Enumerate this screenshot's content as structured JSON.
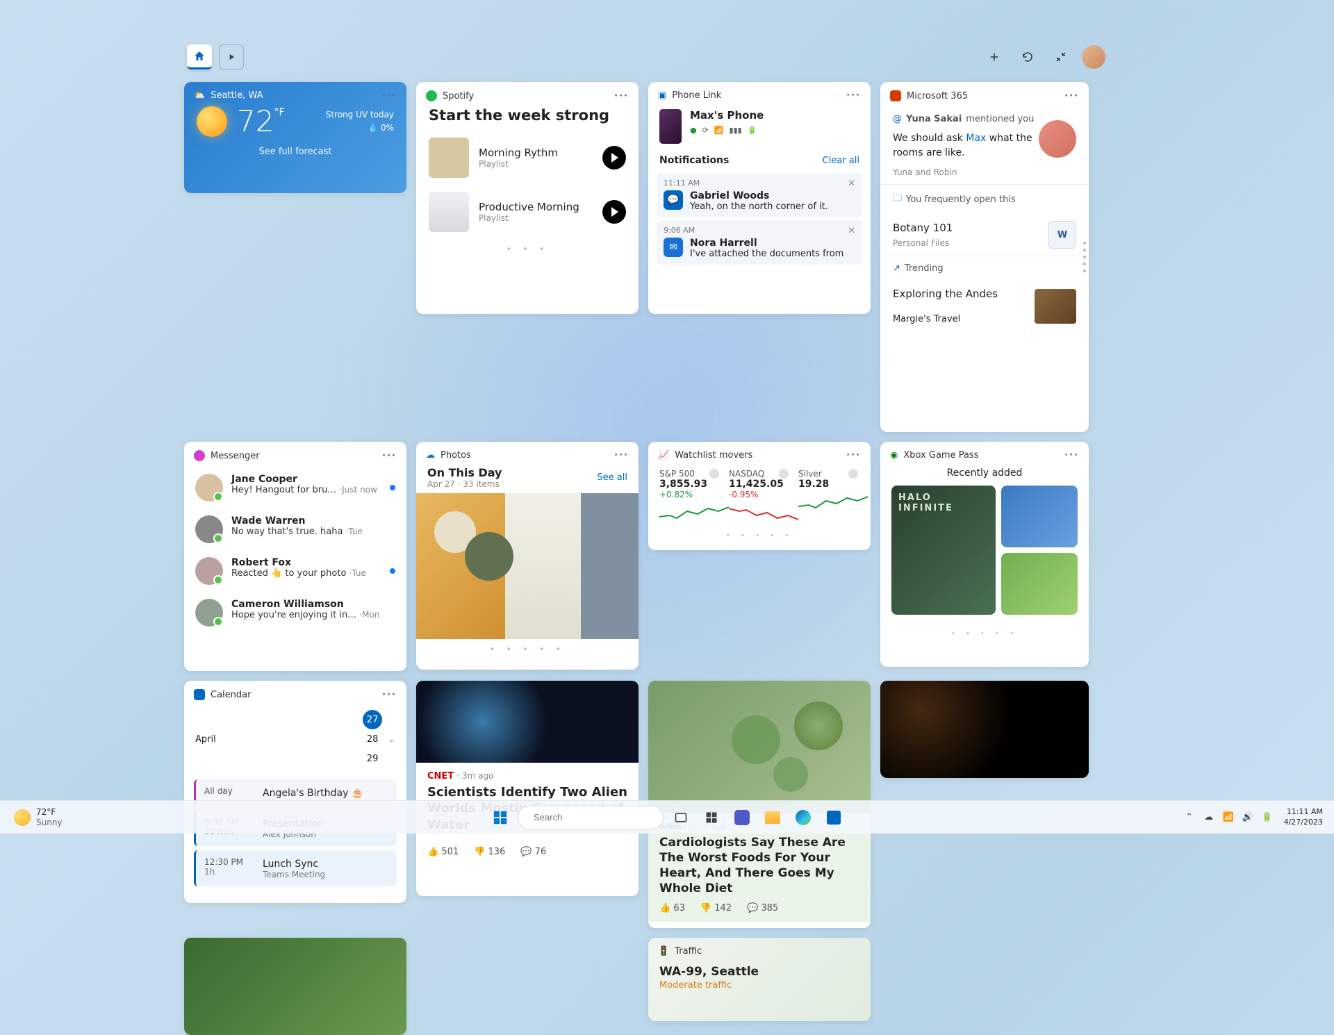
{
  "topbar": {
    "home_label": "Home",
    "play_label": "Play"
  },
  "weather": {
    "title": "Seattle, WA",
    "temp": "72",
    "unit": "°F",
    "note_top": "Strong UV today",
    "note_bottom": "0%",
    "forecast_link": "See full forecast"
  },
  "messenger": {
    "title": "Messenger",
    "items": [
      {
        "name": "Jane Cooper",
        "preview": "Hey! Hangout for bru…",
        "time": "Just now",
        "unread": true,
        "avatar_color": "#d8c0a0"
      },
      {
        "name": "Wade Warren",
        "preview": "No way that's true. haha",
        "time": "Tue",
        "unread": false,
        "avatar_color": "#888"
      },
      {
        "name": "Robert Fox",
        "preview": "Reacted 👆 to your photo",
        "time": "Tue",
        "unread": true,
        "avatar_color": "#bba0a0"
      },
      {
        "name": "Cameron Williamson",
        "preview": "Hope you're enjoying it in…",
        "time": "Mon",
        "unread": false,
        "avatar_color": "#90a090"
      }
    ]
  },
  "calendar": {
    "title": "Calendar",
    "month": "April",
    "days": [
      "27",
      "28",
      "29"
    ],
    "selected_index": 0,
    "events": [
      {
        "slot": "All day",
        "dur": "",
        "title": "Angela's Birthday 🎂",
        "sub": "",
        "accent": "pink"
      },
      {
        "slot": "8:30 AM",
        "dur": "30 min",
        "title": "Presentation",
        "sub": "Alex Johnson",
        "accent": "blue"
      },
      {
        "slot": "12:30 PM",
        "dur": "1h",
        "title": "Lunch Sync",
        "sub": "Teams Meeting",
        "accent": "blue"
      }
    ]
  },
  "spotify": {
    "title": "Spotify",
    "headline": "Start the week strong",
    "items": [
      {
        "name": "Morning Rythm",
        "sub": "Playlist"
      },
      {
        "name": "Productive Morning",
        "sub": "Playlist"
      }
    ]
  },
  "photos": {
    "title": "Photos",
    "headline": "On This Day",
    "meta": "Apr 27 · 33 items",
    "see_all": "See all"
  },
  "cnet": {
    "source": "CNET",
    "time": "3m ago",
    "headline": "Scientists Identify Two Alien Worlds Mostly Composed of Water",
    "likes": "501",
    "dislikes": "136",
    "comments": "76"
  },
  "phonelink": {
    "title": "Phone Link",
    "phone_name": "Max's Phone",
    "notifications_label": "Notifications",
    "clear_all": "Clear all",
    "items": [
      {
        "time": "11:11 AM",
        "name": "Gabriel Woods",
        "preview": "Yeah, on the north corner of it.",
        "app": "chat"
      },
      {
        "time": "9:06 AM",
        "name": "Nora Harrell",
        "preview": "I've attached the documents from",
        "app": "outlook"
      }
    ]
  },
  "watchlist": {
    "title": "Watchlist movers",
    "items": [
      {
        "name": "S&P 500",
        "value": "3,855.93",
        "pct": "+0.82%",
        "dir": "up"
      },
      {
        "name": "NASDAQ",
        "value": "11,425.05",
        "pct": "-0.95%",
        "dir": "dn"
      },
      {
        "name": "Silver",
        "value": "19.28",
        "pct": "",
        "dir": "up"
      }
    ]
  },
  "delish": {
    "source": "delish",
    "time": "21m ago",
    "headline": "Cardiologists Say These Are The Worst Foods For Your Heart, And There Goes My Whole Diet",
    "likes": "63",
    "dislikes": "142",
    "comments": "385"
  },
  "m365": {
    "title": "Microsoft 365",
    "mention_by": "Yuna Sakai",
    "mention_label": "mentioned you",
    "msg_pre": "We should ask ",
    "msg_hl": "Max",
    "msg_post": " what the rooms are like.",
    "who": "Yuna and Robin",
    "freq_label": "You frequently open this",
    "doc_name": "Botany 101",
    "doc_loc": "Personal Files",
    "trending_label": "Trending",
    "trend_title": "Exploring the Andes",
    "trend_sub": "Margie's Travel"
  },
  "xbox": {
    "title": "Xbox Game Pass",
    "subtitle": "Recently added"
  },
  "traffic": {
    "title": "Traffic",
    "loc": "WA-99, Seattle",
    "status": "Moderate traffic"
  },
  "taskbar": {
    "wx_temp": "72°F",
    "wx_cond": "Sunny",
    "search_placeholder": "Search",
    "time": "11:11 AM",
    "date": "4/27/2023"
  }
}
